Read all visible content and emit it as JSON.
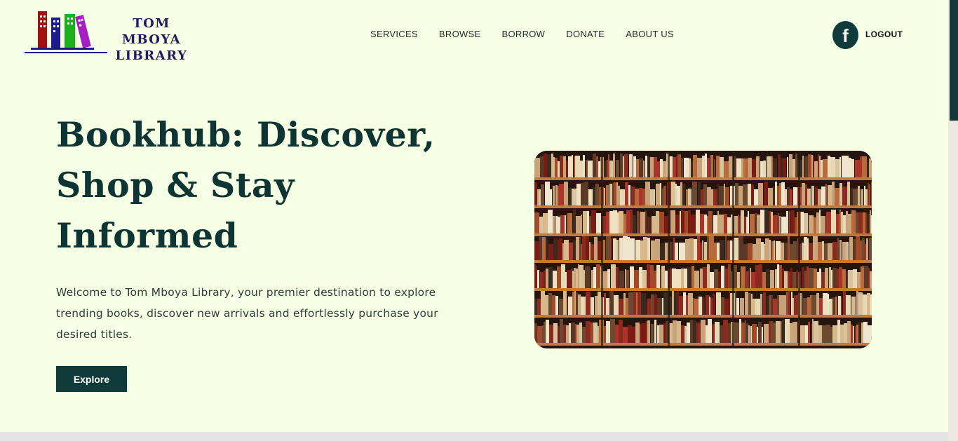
{
  "brand": {
    "line1": "TOM MBOYA",
    "line2": "LIBRARY",
    "book_colors": [
      "#a10f0f",
      "#1c1a8c",
      "#1fae1f",
      "#a41fc4"
    ]
  },
  "nav": {
    "items": [
      {
        "label": "SERVICES"
      },
      {
        "label": "BROWSE"
      },
      {
        "label": "BORROW"
      },
      {
        "label": "DONATE"
      },
      {
        "label": "ABOUT US"
      }
    ]
  },
  "header": {
    "facebook_icon": "f",
    "logout_label": "LOGOUT"
  },
  "hero": {
    "title_line1": "Bookhub: Discover,",
    "title_line2": "Shop & Stay",
    "title_line3": "Informed",
    "description": "Welcome to Tom Mboya Library, your premier destination to explore trending books, discover new arrivals and effortlessly purchase your desired titles.",
    "cta_label": "Explore"
  },
  "theme": {
    "background": "#f5ffe3",
    "primary": "#0f3b3a",
    "brand_text": "#241a5e"
  }
}
